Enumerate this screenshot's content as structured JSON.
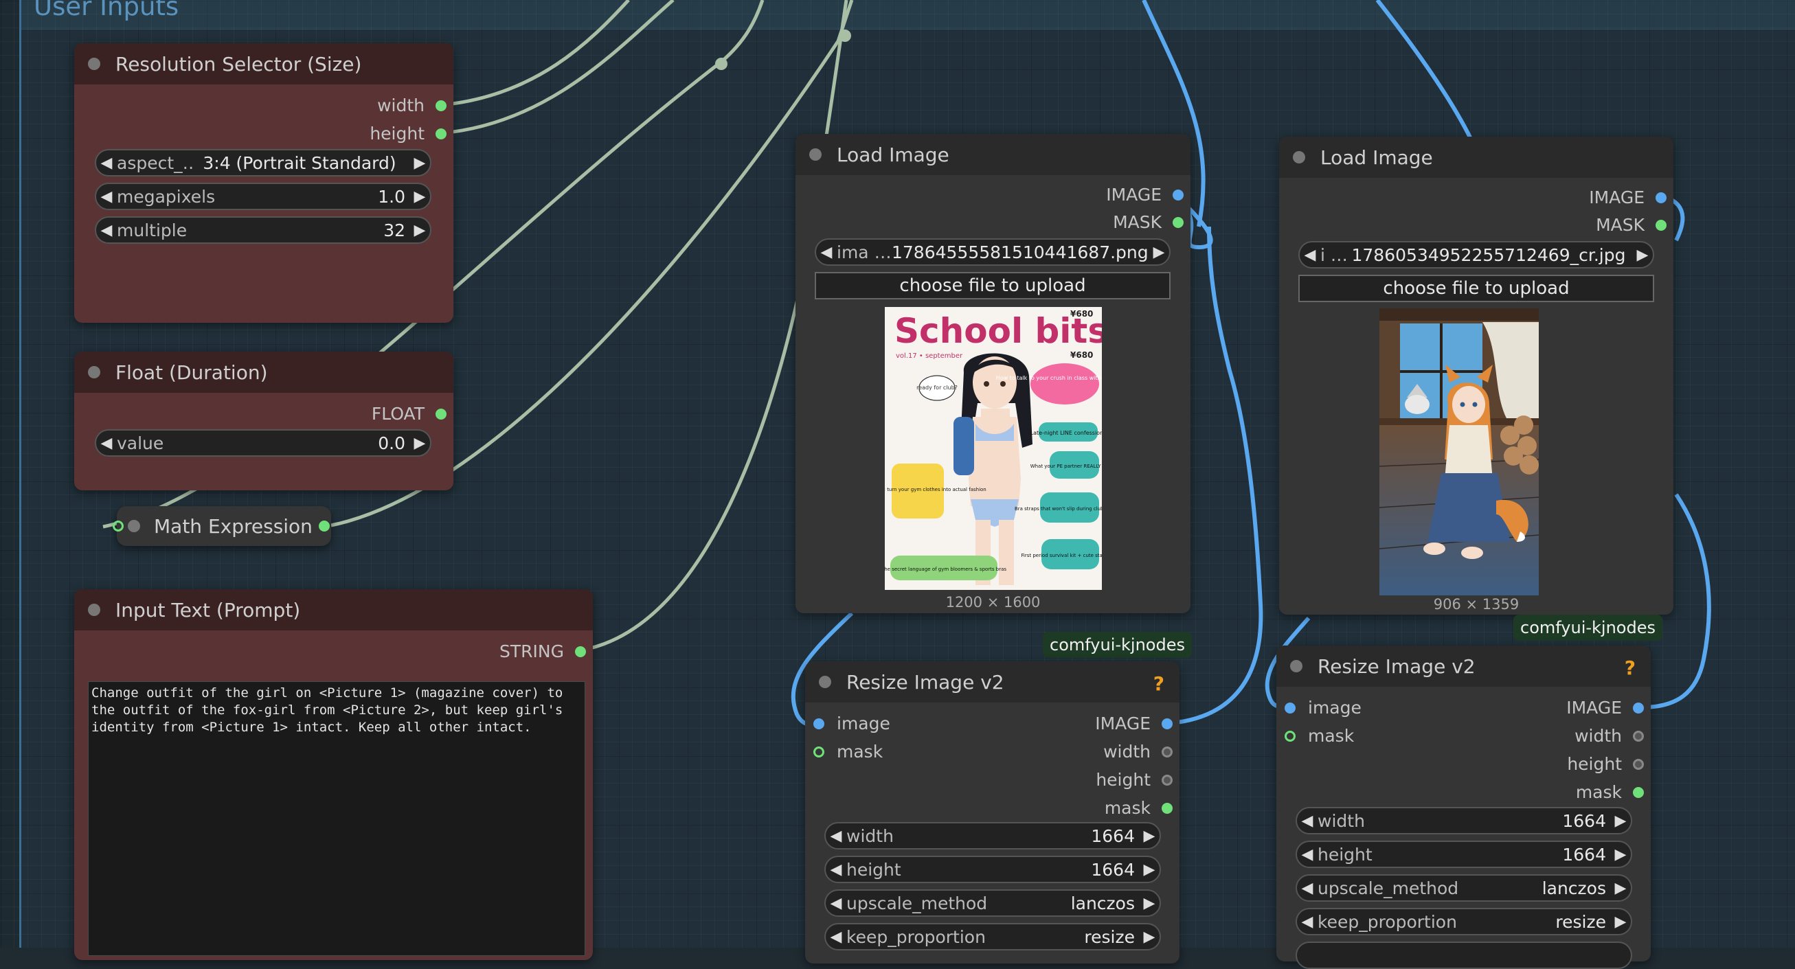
{
  "group": {
    "title": "User Inputs"
  },
  "resolution_node": {
    "title": "Resolution Selector (Size)",
    "outputs": [
      "width",
      "height"
    ],
    "widgets": [
      {
        "label": "aspect_…",
        "value": "3:4 (Portrait Standard)"
      },
      {
        "label": "megapixels",
        "value": "1.0"
      },
      {
        "label": "multiple",
        "value": "32"
      }
    ]
  },
  "float_node": {
    "title": "Float (Duration)",
    "output": "FLOAT",
    "widget": {
      "label": "value",
      "value": "0.0"
    }
  },
  "math_node": {
    "title": "Math Expression"
  },
  "prompt_node": {
    "title": "Input Text (Prompt)",
    "output": "STRING",
    "text": "Change outfit of the girl on <Picture 1> (magazine cover) to\nthe outfit of the fox-girl from <Picture 2>, but keep girl's\nidentity from <Picture 1> intact. Keep all other intact."
  },
  "load_image_1": {
    "title": "Load Image",
    "outputs": [
      "IMAGE",
      "MASK"
    ],
    "file": {
      "label": "ima …",
      "value": "1786455558151044168​7.png"
    },
    "upload_label": "choose file to upload",
    "dimensions": "1200 × 1600",
    "cover": {
      "title": "School bits",
      "price_top": "¥680",
      "price_sub": "¥680",
      "issue": "vol.17 • september",
      "bubble_ready": "ready for club?",
      "bubble_pink": "How to talk to your crush in class without dying ♥",
      "bubble_line": "Late-night LINE confessions",
      "bubble_pe": "What your PE partner REALLY means",
      "bubble_uniform": "Uniform hacks: turn your gym clothes into actual fashion",
      "bubble_bra": "Bra straps that won't slip during club practice",
      "bubble_period": "First period survival kit + cute stationery",
      "bubble_secret": "The secret language of gym bloomers & sports bras"
    }
  },
  "load_image_2": {
    "title": "Load Image",
    "outputs": [
      "IMAGE",
      "MASK"
    ],
    "file": {
      "label": "i …",
      "value": "17860534952255712469_cr.jpg"
    },
    "upload_label": "choose file to upload",
    "dimensions": "906 × 1359"
  },
  "resize_1": {
    "badge": "comfyui-kjnodes",
    "title": "Resize Image v2",
    "help": "?",
    "inputs": [
      "image",
      "mask"
    ],
    "outputs": [
      "IMAGE",
      "width",
      "height",
      "mask"
    ],
    "widgets": [
      {
        "label": "width",
        "value": "1664"
      },
      {
        "label": "height",
        "value": "1664"
      },
      {
        "label": "upscale_method",
        "value": "lanczos"
      },
      {
        "label": "keep_proportion",
        "value": "resize"
      }
    ]
  },
  "resize_2": {
    "badge": "comfyui-kjnodes",
    "title": "Resize Image v2",
    "help": "?",
    "inputs": [
      "image",
      "mask"
    ],
    "outputs": [
      "IMAGE",
      "width",
      "height",
      "mask"
    ],
    "widgets": [
      {
        "label": "width",
        "value": "1664"
      },
      {
        "label": "height",
        "value": "1664"
      },
      {
        "label": "upscale_method",
        "value": "lanczos"
      },
      {
        "label": "keep_proportion",
        "value": "resize"
      }
    ]
  },
  "colors": {
    "canvas": "#1e2a32",
    "node_red": "#5a3434",
    "node_gray": "#353535",
    "wire_blue": "#5aa8f0",
    "wire_green": "#a8bfa6",
    "socket_green": "#6fe07a",
    "help_icon": "#f0a020"
  }
}
